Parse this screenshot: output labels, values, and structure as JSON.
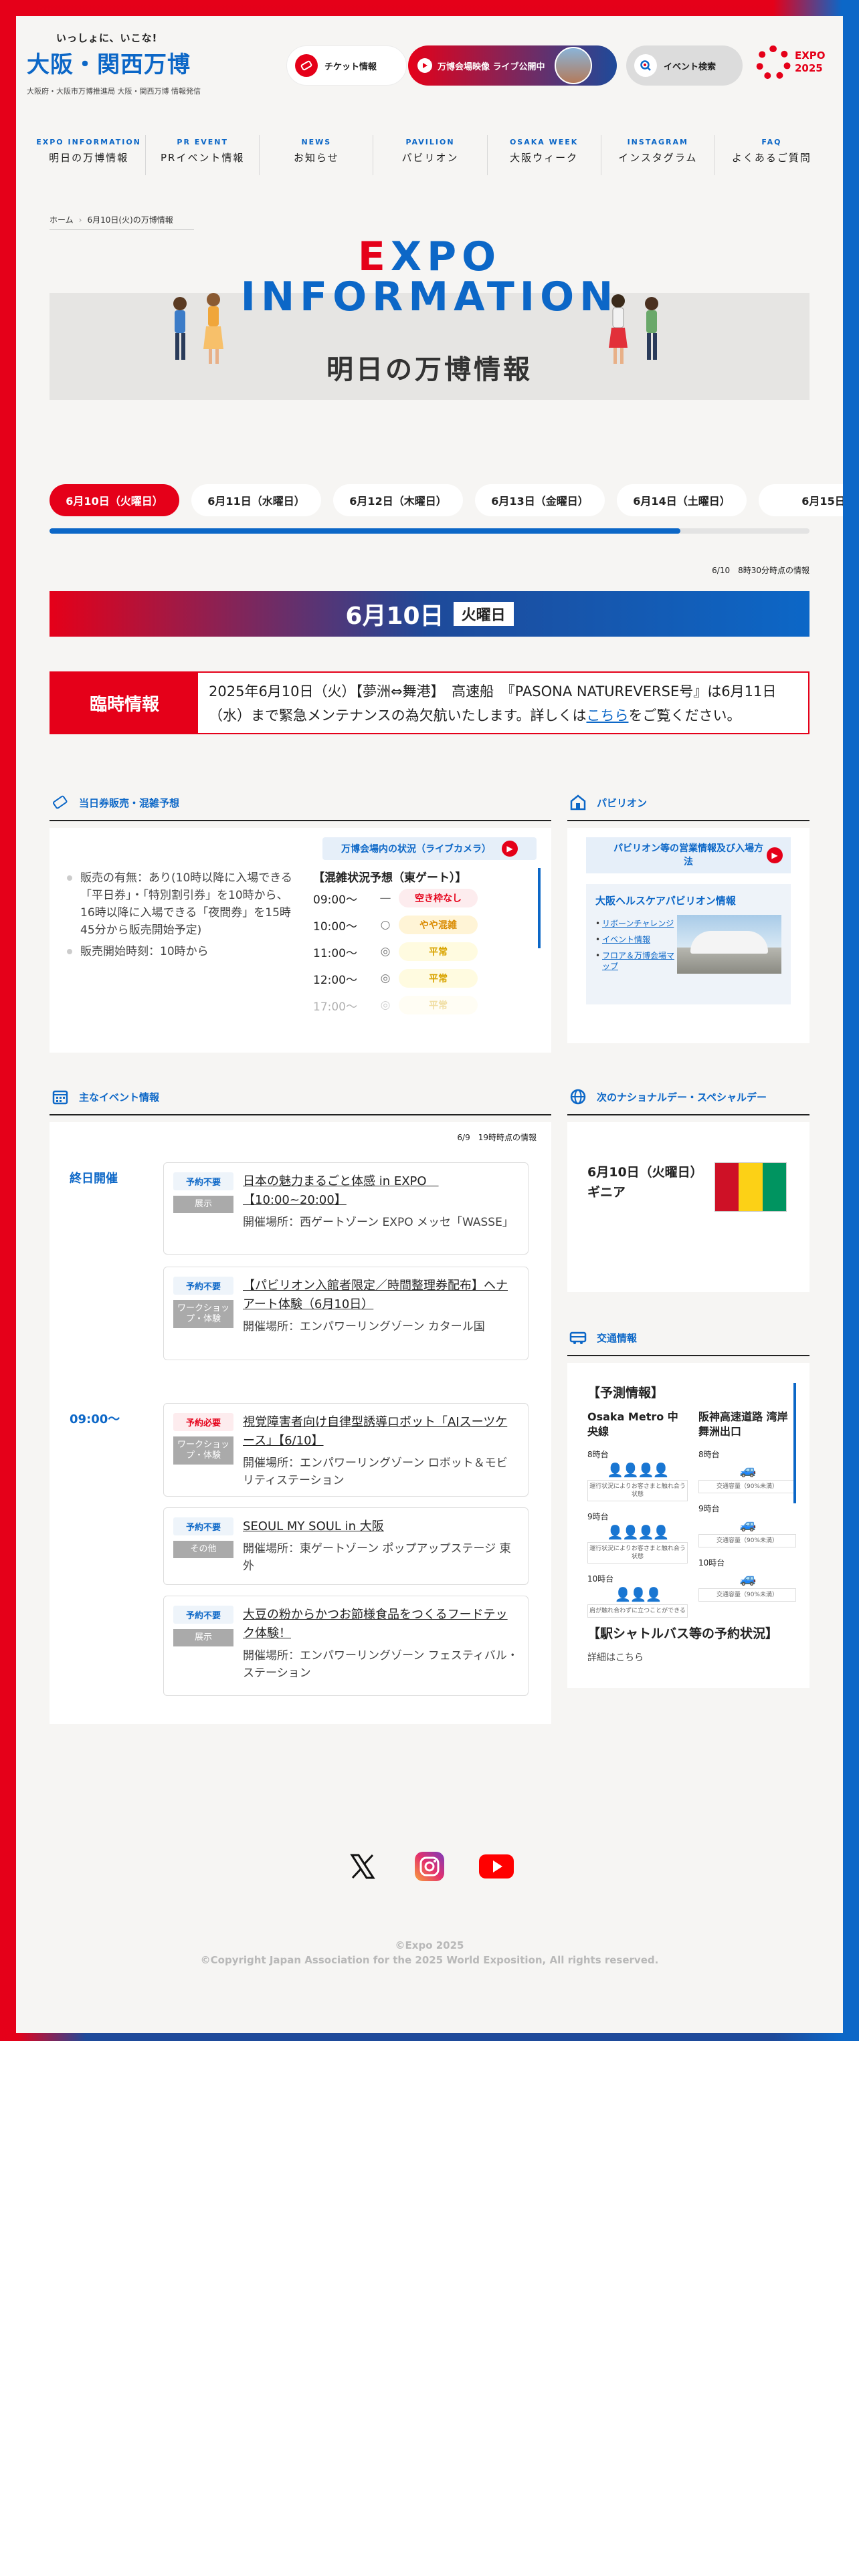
{
  "header": {
    "catch": "いっしょに、いこな!",
    "logo_main": "大阪・関西万博",
    "logo_sub": "大阪府・大阪市万博推進局 大阪・関西万博 情報発信",
    "ticket_label": "チケット情報",
    "live_label": "万博会場映像 ライブ公開中",
    "event_search_label": "イベント検索",
    "expo_logo_text1": "EXPO",
    "expo_logo_text2": "2025"
  },
  "nav": [
    {
      "en": "EXPO INFORMATION",
      "jp": "明日の万博情報"
    },
    {
      "en": "PR EVENT",
      "jp": "PRイベント情報"
    },
    {
      "en": "NEWS",
      "jp": "お知らせ"
    },
    {
      "en": "PAVILION",
      "jp": "パビリオン"
    },
    {
      "en": "OSAKA WEEK",
      "jp": "大阪ウィーク"
    },
    {
      "en": "INSTAGRAM",
      "jp": "インスタグラム"
    },
    {
      "en": "FAQ",
      "jp": "よくあるご質問"
    }
  ],
  "breadcrumb": {
    "home": "ホーム",
    "current": "6月10日(火)の万博情報"
  },
  "hero": {
    "title_first": "E",
    "title_rest": "XPO",
    "title_line2": "INFORMATION",
    "subtitle": "明日の万博情報"
  },
  "date_tabs": [
    "6月10日（火曜日）",
    "6月11日（水曜日）",
    "6月12日（木曜日）",
    "6月13日（金曜日）",
    "6月14日（土曜日）",
    "6月15日"
  ],
  "date_tabs_scroll": 0.83,
  "as_of": "6/10　8時30分時点の情報",
  "date_bar": {
    "date": "6月10日",
    "dow": "火曜日"
  },
  "notice": {
    "label": "臨時情報",
    "text": "2025年6月10日（火）【夢洲⇔舞港】　高速船　『PASONA NATUREVERSE号』は6月11日（水）まで緊急メンテナンスの為欠航いたします。詳しくは",
    "link": "こちら",
    "tail": "をご覧ください。"
  },
  "ticket": {
    "heading": "当日券販売・混雑予想",
    "live_btn": "万博会場内の状況（ライブカメラ）",
    "items": [
      "販売の有無：あり(10時以降に入場できる「平日券」・「特別割引券」を10時から、16時以降に入場できる「夜間券」を15時45分から販売開始予定)",
      "販売開始時刻：10時から"
    ],
    "congestion_title": "【混雑状況予想（東ゲート）】",
    "congestion": [
      {
        "time": "09:00〜",
        "mark": "—",
        "label": "空き枠なし",
        "color": "#e50019",
        "bg": "#fdecee"
      },
      {
        "time": "10:00〜",
        "mark": "○",
        "label": "やや混雑",
        "color": "#d98a00",
        "bg": "#fff4d6"
      },
      {
        "time": "11:00〜",
        "mark": "◎",
        "label": "平常",
        "color": "#d9a400",
        "bg": "#fffbe0"
      },
      {
        "time": "12:00〜",
        "mark": "◎",
        "label": "平常",
        "color": "#d9a400",
        "bg": "#fffbe0"
      },
      {
        "time": "17:00〜",
        "mark": "◎",
        "label": "平常",
        "color": "#d9a400",
        "bg": "#fffbe0"
      }
    ]
  },
  "pavilion": {
    "heading": "パビリオン",
    "btn": "パビリオン等の営業情報及び入場方法",
    "feature_title": "大阪ヘルスケアパビリオン情報",
    "links": [
      "リボーンチャレンジ",
      "イベント情報",
      "フロア＆万博会場マップ"
    ]
  },
  "events": {
    "heading": "主なイベント情報",
    "as_of": "6/9　19時時点の情報",
    "group1_time": "終日開催",
    "group2_time": "09:00〜",
    "items": [
      {
        "badge": "予約不要",
        "cat": "展示",
        "title": "日本の魅力まるごと体感 in EXPO　【10:00~20:00】",
        "place": "開催場所：西ゲートゾーン EXPO メッセ「WASSE」"
      },
      {
        "badge": "予約不要",
        "cat": "ワークショップ・体験",
        "title": "【パビリオン入館者限定／時間整理券配布】ヘナアート体験（6月10日）",
        "place": "開催場所：エンパワーリングゾーン カタール国"
      },
      {
        "badge": "予約必要",
        "cat": "ワークショップ・体験",
        "title": "視覚障害者向け自律型誘導ロボット「AIスーツケース」【6/10】",
        "place": "開催場所：エンパワーリングゾーン ロボット＆モビリティステーション"
      },
      {
        "badge": "予約不要",
        "cat": "その他",
        "title": "SEOUL MY SOUL in 大阪",
        "place": "開催場所：東ゲートゾーン ポップアップステージ 東外"
      },
      {
        "badge": "予約不要",
        "cat": "展示",
        "title": "大豆の粉からかつお節様食品をつくるフードテック体験！",
        "place": "開催場所：エンパワーリングゾーン フェスティバル・ステーション"
      }
    ]
  },
  "national_day": {
    "heading": "次のナショナルデー・スペシャルデー",
    "date": "6月10日（火曜日）",
    "country": "ギニア",
    "flag_colors": [
      "#ce1126",
      "#fcd116",
      "#009460"
    ]
  },
  "traffic": {
    "heading": "交通情報",
    "forecast": "【予測情報】",
    "col1_name": "Osaka Metro 中央線",
    "col2_name": "阪神高速道路 湾岸舞洲出口",
    "rows1": [
      {
        "time": "8時台",
        "note": "運行状況によりお客さまと触れ合う状態"
      },
      {
        "time": "9時台",
        "note": "運行状況によりお客さまと触れ合う状態"
      },
      {
        "time": "10時台",
        "note": "肩が触れ合わずに立つことができる"
      }
    ],
    "rows2": [
      {
        "time": "8時台",
        "note": "交通容量（90%未満）"
      },
      {
        "time": "9時台",
        "note": "交通容量（90%未満）"
      },
      {
        "time": "10時台",
        "note": "交通容量（90%未満）"
      }
    ],
    "shuttle": "【駅シャトルバス等の予約状況】",
    "detail": "詳細はこちら"
  },
  "footer": {
    "expo": "©Expo 2025",
    "copy": "©Copyright Japan Association for the 2025 World Exposition, All rights reserved."
  }
}
